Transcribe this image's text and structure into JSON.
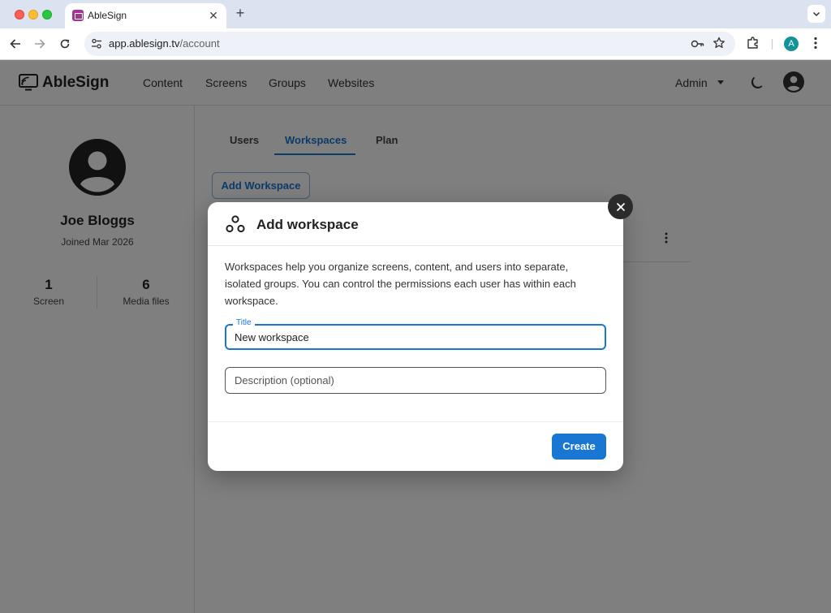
{
  "browser": {
    "tab_title": "AbleSign",
    "tab_close": "✕",
    "new_tab": "+",
    "url_host": "app.ablesign.tv",
    "url_path": "/account",
    "profile_initial": "A"
  },
  "app": {
    "logo_text": "AbleSign",
    "nav": [
      "Content",
      "Screens",
      "Groups",
      "Websites"
    ],
    "admin_label": "Admin"
  },
  "profile": {
    "name": "Joe Bloggs",
    "joined": "Joined Mar 2026",
    "stats": [
      {
        "value": "1",
        "label": "Screen"
      },
      {
        "value": "6",
        "label": "Media files"
      }
    ]
  },
  "main": {
    "tabs": [
      "Users",
      "Workspaces",
      "Plan"
    ],
    "active_tab": "Workspaces",
    "add_workspace_label": "Add Workspace"
  },
  "dialog": {
    "title": "Add workspace",
    "description": "Workspaces help you organize screens, content, and users into separate, isolated groups. You can control the permissions each user has within each workspace.",
    "title_field_label": "Title",
    "title_field_value": "New workspace",
    "description_placeholder": "Description (optional)",
    "create_label": "Create"
  },
  "colors": {
    "accent": "#1976d2",
    "favicon": "#a2358f",
    "profile": "#12939a"
  }
}
